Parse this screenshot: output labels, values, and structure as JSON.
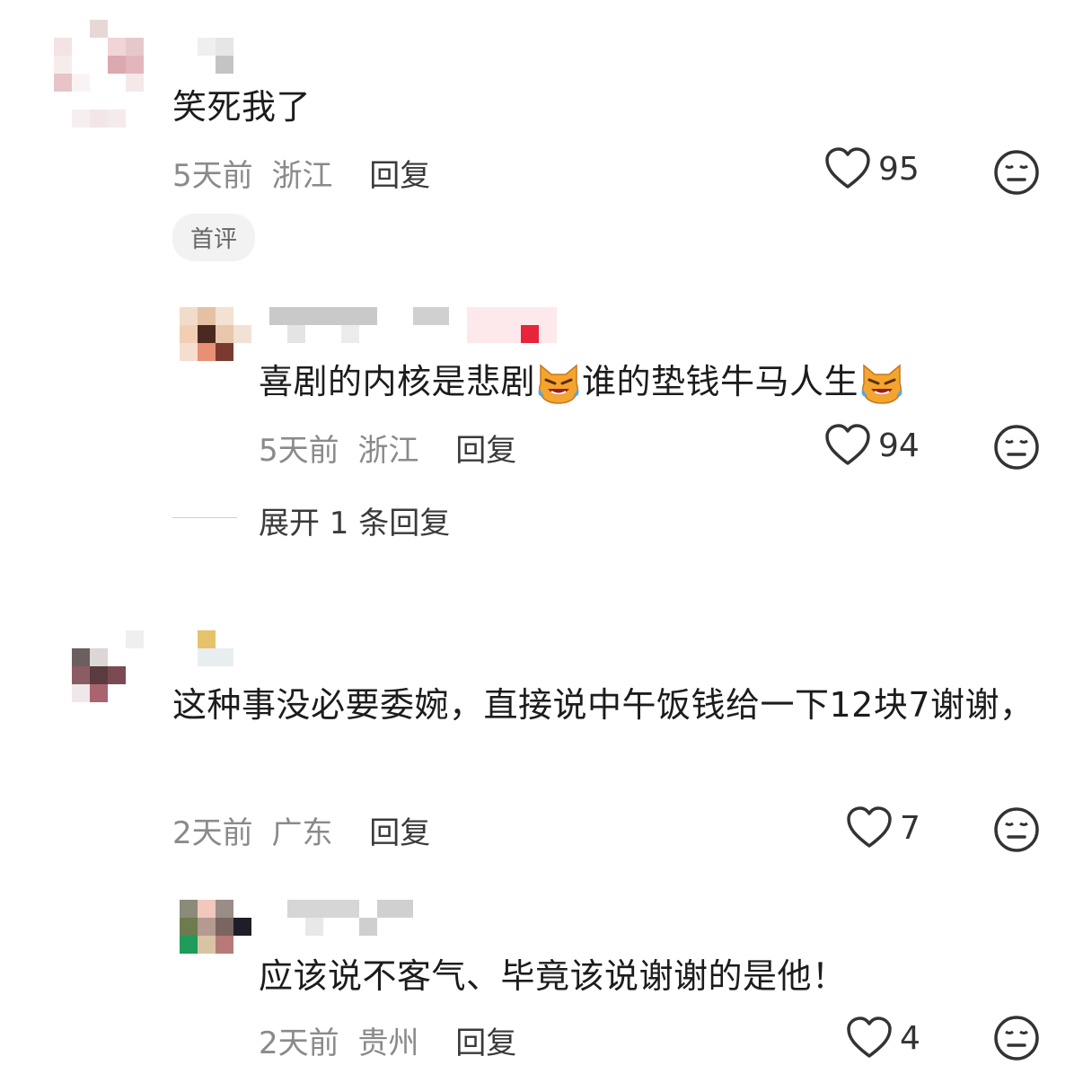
{
  "comments": [
    {
      "text": "笑死我了",
      "time": "5天前",
      "location": "浙江",
      "reply_label": "回复",
      "likes": "95",
      "badge": "首评",
      "replies": [
        {
          "text_part1": "喜剧的内核是悲剧",
          "text_part2": "谁的垫钱牛马人生",
          "time": "5天前",
          "location": "浙江",
          "reply_label": "回复",
          "likes": "94"
        }
      ],
      "expand_label": "展开 1 条回复"
    },
    {
      "text": "这种事没必要委婉，直接说中午饭钱给一下12块7谢谢，",
      "time": "2天前",
      "location": "广东",
      "reply_label": "回复",
      "likes": "7",
      "replies": [
        {
          "text": "应该说不客气、毕竟该说谢谢的是他！",
          "time": "2天前",
          "location": "贵州",
          "reply_label": "回复",
          "likes": "4"
        }
      ]
    }
  ],
  "icons": {
    "like": "heart-outline-icon",
    "react": "neutral-face-icon",
    "emoji": "crying-laughing-cat-emoji"
  },
  "colors": {
    "meta": "#8a8a8a",
    "text": "#1c1c1c",
    "badge_bg": "#f2f2f2"
  }
}
